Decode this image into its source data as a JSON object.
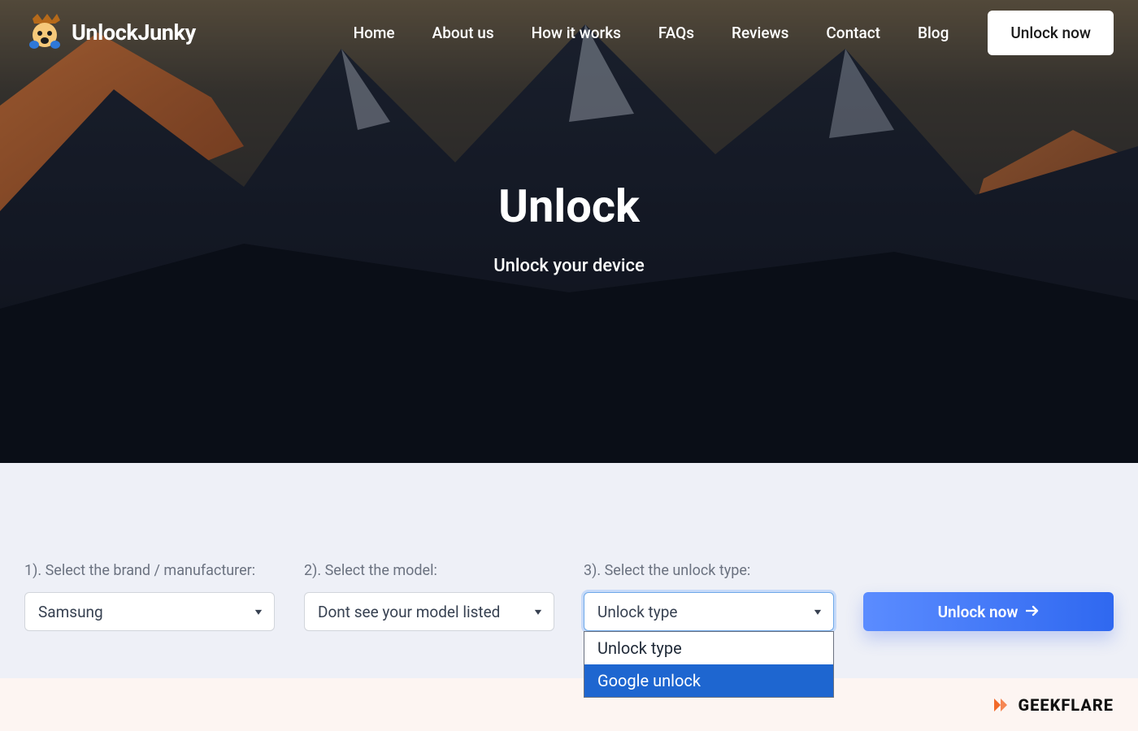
{
  "brand": "UnlockJunky",
  "nav": {
    "items": [
      "Home",
      "About us",
      "How it works",
      "FAQs",
      "Reviews",
      "Contact",
      "Blog"
    ],
    "cta": "Unlock now"
  },
  "hero": {
    "title": "Unlock",
    "subtitle": "Unlock your device"
  },
  "form": {
    "step1": {
      "label": "1). Select the brand / manufacturer:",
      "value": "Samsung"
    },
    "step2": {
      "label": "2). Select the model:",
      "value": "Dont see your model listed"
    },
    "step3": {
      "label": "3). Select the unlock type:",
      "value": "Unlock type",
      "options": [
        "Unlock type",
        "Google unlock"
      ],
      "highlighted_index": 1
    },
    "submit": "Unlock now"
  },
  "footer": {
    "brand": "GEEKFLARE"
  },
  "colors": {
    "accent": "#1e66d0",
    "button_gradient_from": "#5b8cff",
    "button_gradient_to": "#2f68f0"
  }
}
